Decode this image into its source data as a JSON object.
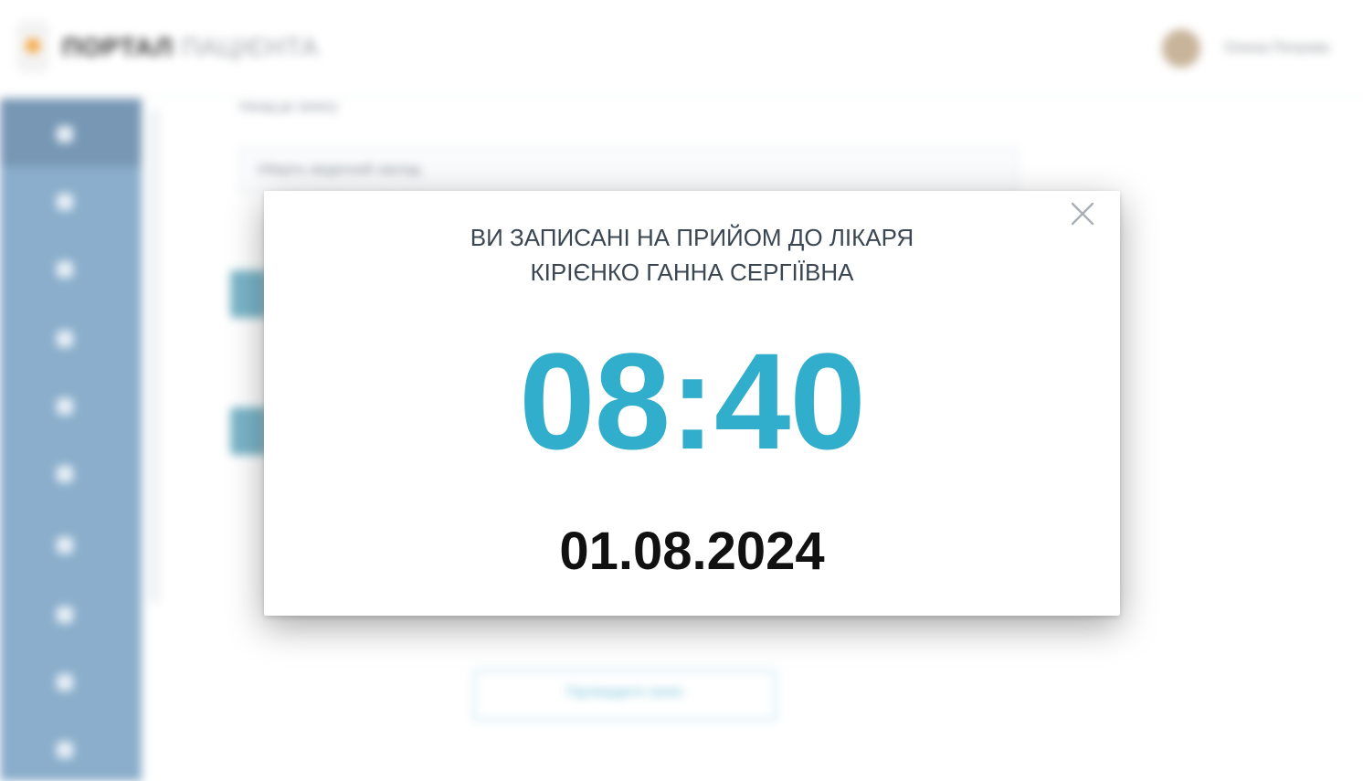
{
  "header": {
    "logo_bold": "ПОРТАЛ",
    "logo_light": "ПАЦІЄНТА",
    "user_name": "Олена Петрова"
  },
  "sidebar": {
    "icons": [
      "home-icon",
      "user-icon",
      "calendar-icon",
      "chat-icon",
      "stethoscope-icon",
      "chart-icon",
      "family-icon",
      "profile-icon",
      "doctor-icon",
      "settings-icon"
    ]
  },
  "background": {
    "back_link": "Назад до запису",
    "select_placeholder": "Оберіть медичний заклад",
    "outline_button": "Підтвердити запис"
  },
  "modal": {
    "title_line1": "ВИ ЗАПИСАНІ НА ПРИЙОМ ДО ЛІКАРЯ",
    "title_line2": "КІРІЄНКО ГАННА СЕРГІЇВНА",
    "time": "08:40",
    "date": "01.08.2024",
    "close_icon": "close-icon"
  },
  "colors": {
    "accent": "#30aecb",
    "sidebar": "#8aaecb",
    "title": "#3a4652",
    "date": "#111111"
  }
}
